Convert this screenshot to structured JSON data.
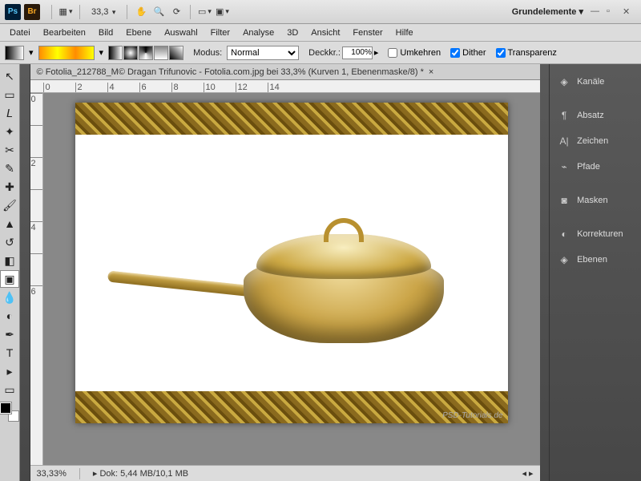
{
  "titlebar": {
    "zoom": "33,3",
    "workspace": "Grundelemente"
  },
  "menus": [
    "Datei",
    "Bearbeiten",
    "Bild",
    "Ebene",
    "Auswahl",
    "Filter",
    "Analyse",
    "3D",
    "Ansicht",
    "Fenster",
    "Hilfe"
  ],
  "options": {
    "modus_label": "Modus:",
    "modus_value": "Normal",
    "deckkr_label": "Deckkr.:",
    "deckkr_value": "100%",
    "umkehren": "Umkehren",
    "dither": "Dither",
    "transparenz": "Transparenz"
  },
  "doc": {
    "title": "© Fotolia_212788_M© Dragan Trifunovic - Fotolia.com.jpg bei 33,3% (Kurven 1, Ebenenmaske/8) *"
  },
  "ruler_h": [
    "0",
    "2",
    "4",
    "6",
    "8",
    "10",
    "12",
    "14"
  ],
  "ruler_v": [
    "0",
    "",
    "2",
    "",
    "4",
    "",
    "6"
  ],
  "status": {
    "zoom": "33,33%",
    "doc": "Dok: 5,44 MB/10,1 MB"
  },
  "panels": [
    "Kanäle",
    "Absatz",
    "Zeichen",
    "Pfade",
    "Masken",
    "Korrekturen",
    "Ebenen"
  ],
  "watermark": "PSD-Tutorials.de"
}
